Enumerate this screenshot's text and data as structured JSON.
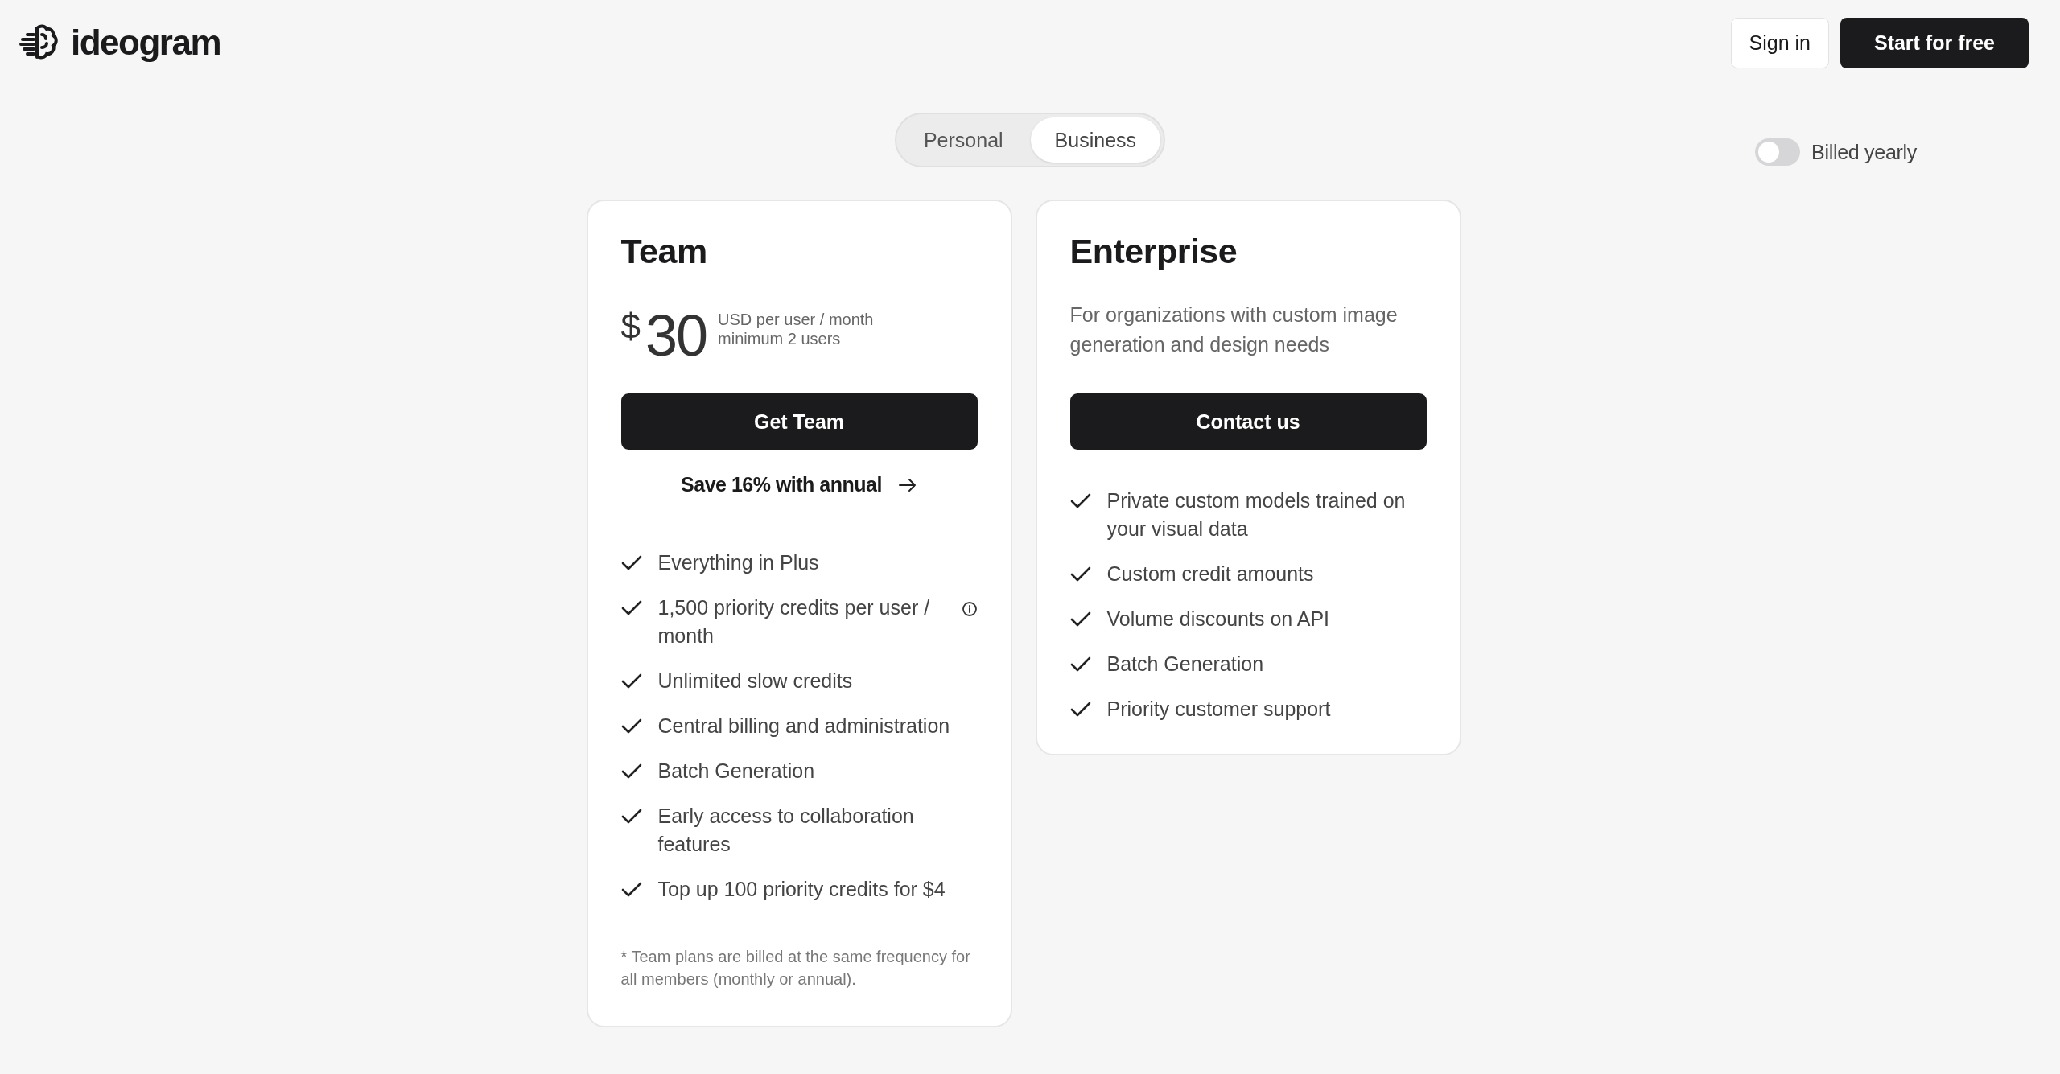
{
  "header": {
    "brand": "ideogram",
    "sign_in": "Sign in",
    "start": "Start for free"
  },
  "plan_tabs": [
    {
      "label": "Personal",
      "selected": false
    },
    {
      "label": "Business",
      "selected": true
    }
  ],
  "billing_toggle": {
    "label": "Billed yearly",
    "on": false
  },
  "plans": [
    {
      "name": "Team",
      "currency": "$",
      "price": "30",
      "price_note": [
        "USD per user / month",
        "minimum 2 users"
      ],
      "button": "Get Team",
      "save_link": "Save 16% with annual",
      "features": [
        {
          "text": "Everything in Plus",
          "info": false
        },
        {
          "text": "1,500 priority credits per user / month",
          "info": true
        },
        {
          "text": "Unlimited slow credits",
          "info": false
        },
        {
          "text": "Central billing and administration",
          "info": false
        },
        {
          "text": "Batch Generation",
          "info": false
        },
        {
          "text": "Early access to collaboration features",
          "info": false
        },
        {
          "text": "Top up 100 priority credits for $4",
          "info": false
        }
      ],
      "footnote": "* Team plans are billed at the same frequency for all members (monthly or annual)."
    },
    {
      "name": "Enterprise",
      "description": "For organizations with custom image generation and design needs",
      "button": "Contact us",
      "features": [
        {
          "text": "Private custom models trained on your visual data",
          "info": false
        },
        {
          "text": "Custom credit amounts",
          "info": false
        },
        {
          "text": "Volume discounts on API",
          "info": false
        },
        {
          "text": "Batch Generation",
          "info": false
        },
        {
          "text": "Priority customer support",
          "info": false
        }
      ]
    }
  ]
}
